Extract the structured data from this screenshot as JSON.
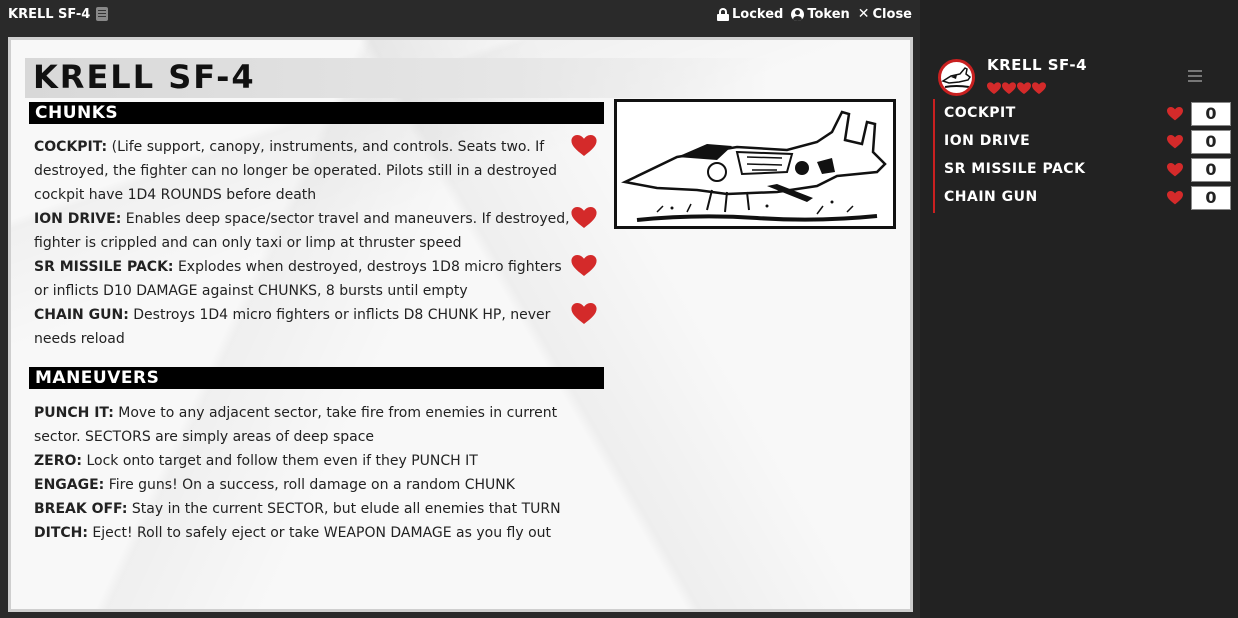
{
  "window": {
    "title": "KRELL SF-4",
    "controls": {
      "locked": "Locked",
      "token": "Token",
      "close": "Close"
    }
  },
  "sheet": {
    "title": "KRELL SF-4",
    "chunks_heading": "CHUNKS",
    "chunks": [
      {
        "name": "COCKPIT:",
        "desc": " (Life support, canopy, instruments, and controls. Seats two. If destroyed, the fighter can no longer be operated. Pilots still in a destroyed cockpit have 1D4 ROUNDS before death"
      },
      {
        "name": "ION DRIVE:",
        "desc": " Enables deep space/sector travel and maneuvers. If destroyed, fighter is crippled and can only taxi or limp at thruster speed"
      },
      {
        "name": "SR MISSILE PACK:",
        "desc": " Explodes when destroyed, destroys 1D8 micro fighters or inflicts D10 DAMAGE against CHUNKS, 8 bursts until empty"
      },
      {
        "name": "CHAIN GUN:",
        "desc": " Destroys 1D4 micro fighters or inflicts D8 CHUNK HP, never needs reload"
      }
    ],
    "maneuvers_heading": "MANEUVERS",
    "maneuvers": [
      {
        "name": "PUNCH IT:",
        "desc": " Move to any adjacent sector, take fire from enemies in current sector. SECTORS are simply areas of deep space"
      },
      {
        "name": "ZERO:",
        "desc": " Lock onto target and follow them even if they PUNCH IT"
      },
      {
        "name": "ENGAGE:",
        "desc": " Fire guns! On a success, roll damage on a random CHUNK"
      },
      {
        "name": "BREAK OFF:",
        "desc": " Stay in the current SECTOR, but elude all enemies that TURN"
      },
      {
        "name": "DITCH:",
        "desc": " Eject! Roll to safely eject or take WEAPON DAMAGE as you fly out"
      }
    ]
  },
  "panel": {
    "name": "KRELL SF-4",
    "hearts": 4,
    "chunks": [
      {
        "label": "COCKPIT",
        "value": "0"
      },
      {
        "label": "ION DRIVE",
        "value": "0"
      },
      {
        "label": "SR MISSILE PACK",
        "value": "0"
      },
      {
        "label": "CHAIN GUN",
        "value": "0"
      }
    ]
  },
  "colors": {
    "heart": "#d42a2a",
    "accent": "#c92020",
    "ink": "#111111"
  },
  "icons": {
    "lock": "lock-icon",
    "token": "user-circle-icon",
    "close": "close-icon",
    "menu": "menu-icon",
    "heart": "heart-icon"
  }
}
